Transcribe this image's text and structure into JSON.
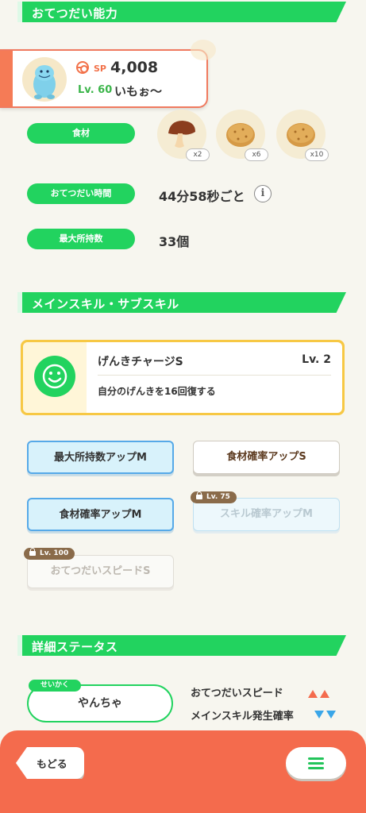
{
  "sections": {
    "helping": "おてつだい能力",
    "skills": "メインスキル・サブスキル",
    "details": "詳細ステータス"
  },
  "pokemon": {
    "sp_label": "SP",
    "sp_value": "4,008",
    "level": "Lv. 60",
    "nickname": "いもぉ〜"
  },
  "stats": {
    "ingredients_label": "食材",
    "ingredients": [
      {
        "name": "mushroom",
        "qty": "x2"
      },
      {
        "name": "potato",
        "qty": "x6"
      },
      {
        "name": "potato",
        "qty": "x10"
      }
    ],
    "help_time_label": "おてつだい時間",
    "help_time_value": "44分58秒ごと",
    "max_carry_label": "最大所持数",
    "max_carry_value": "33個"
  },
  "main_skill": {
    "name": "げんきチャージS",
    "level": "Lv. 2",
    "description": "自分のげんきを16回復する"
  },
  "sub_skills": [
    {
      "label": "最大所持数アップM",
      "style": "blue",
      "locked": false
    },
    {
      "label": "食材確率アップS",
      "style": "white",
      "locked": false
    },
    {
      "label": "食材確率アップM",
      "style": "blue",
      "locked": false
    },
    {
      "label": "スキル確率アップM",
      "style": "blue",
      "locked": true,
      "unlock": "Lv. 75"
    },
    {
      "label": "おてつだいスピードS",
      "style": "white",
      "locked": true,
      "unlock": "Lv. 100"
    }
  ],
  "nature": {
    "tag": "せいかく",
    "value": "やんちゃ",
    "up": "おてつだいスピード",
    "down": "メインスキル発生確率"
  },
  "nav": {
    "back": "もどる"
  },
  "colors": {
    "accent_green": "#22d35f",
    "bottom_bar": "#f46b4d",
    "up_arrow": "#f46b4d",
    "down_arrow": "#3aa6e8"
  }
}
